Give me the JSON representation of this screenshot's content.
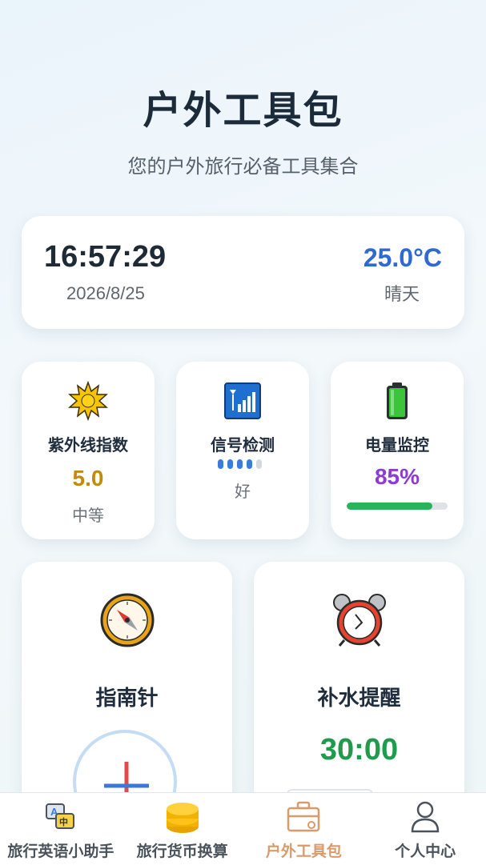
{
  "header": {
    "title": "户外工具包",
    "subtitle": "您的户外旅行必备工具集合"
  },
  "status": {
    "time": "16:57:29",
    "date": "2026/8/25",
    "temperature": "25.0°C",
    "weather": "晴天"
  },
  "uv": {
    "label": "紫外线指数",
    "value": "5.0",
    "level": "中等",
    "icon": "sun-icon"
  },
  "signal": {
    "label": "信号检测",
    "bars_active": 4,
    "bars_total": 5,
    "quality": "好",
    "icon": "signal-icon"
  },
  "battery": {
    "label": "电量监控",
    "value": "85%",
    "level_fraction": 0.85,
    "icon": "battery-icon"
  },
  "compass": {
    "label": "指南针",
    "icon": "compass-icon"
  },
  "hydration": {
    "label": "补水提醒",
    "timer": "30:00",
    "icon": "alarm-clock-icon"
  },
  "tabs": [
    {
      "label": "旅行英语小助手",
      "icon": "translate-icon",
      "active": false
    },
    {
      "label": "旅行货币换算",
      "icon": "coins-icon",
      "active": false
    },
    {
      "label": "户外工具包",
      "icon": "toolbox-icon",
      "active": true
    },
    {
      "label": "个人中心",
      "icon": "user-icon",
      "active": false
    }
  ],
  "colors": {
    "accent": "#2f6ad4",
    "uv": "#c58a0d",
    "battery": "#8c3bd6",
    "timer": "#1e9b4b",
    "active_tab": "#d99a6c"
  }
}
